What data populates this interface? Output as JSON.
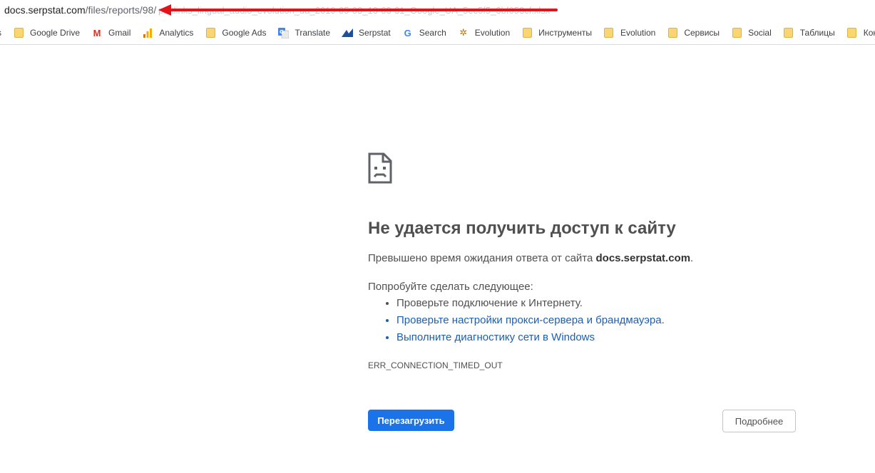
{
  "address_bar": {
    "host": "docs.serpstat.com",
    "path": "/files/reports/98/",
    "obscured_tail": "p...tlinks_lingual_audio_evolution_ua_2019-05-03_13-03-31_Google_UA_5ec5f5_3bf053cf.xlsx"
  },
  "bookmarks": {
    "stub": "s",
    "items": [
      {
        "label": "Google Drive",
        "icon": "folder-icon"
      },
      {
        "label": "Gmail",
        "icon": "gmail-icon"
      },
      {
        "label": "Analytics",
        "icon": "analytics-icon"
      },
      {
        "label": "Google Ads",
        "icon": "folder-icon"
      },
      {
        "label": "Translate",
        "icon": "translate-icon"
      },
      {
        "label": "Serpstat",
        "icon": "serpstat-icon"
      },
      {
        "label": "Search",
        "icon": "google-icon"
      },
      {
        "label": "Evolution",
        "icon": "evolution-icon"
      },
      {
        "label": "Инструменты",
        "icon": "folder-icon"
      },
      {
        "label": "Evolution",
        "icon": "folder-icon"
      },
      {
        "label": "Сервисы",
        "icon": "folder-icon"
      },
      {
        "label": "Social",
        "icon": "folder-icon"
      },
      {
        "label": "Таблицы",
        "icon": "folder-icon"
      },
      {
        "label": "Кон",
        "icon": "folder-icon"
      }
    ]
  },
  "error": {
    "title": "Не удается получить доступ к сайту",
    "message_prefix": "Превышено время ожидания ответа от сайта ",
    "message_host": "docs.serpstat.com",
    "message_suffix": ".",
    "try_heading": "Попробуйте сделать следующее:",
    "suggestions": [
      "Проверьте подключение к Интернету.",
      "Проверьте настройки прокси-сервера и брандмауэра.",
      "Выполните диагностику сети в Windows"
    ],
    "code": "ERR_CONNECTION_TIMED_OUT",
    "reload_label": "Перезагрузить",
    "details_label": "Подробнее"
  },
  "colors": {
    "accent": "#1a73e8",
    "link": "#1a5fb4",
    "annotation": "#e2141a"
  }
}
